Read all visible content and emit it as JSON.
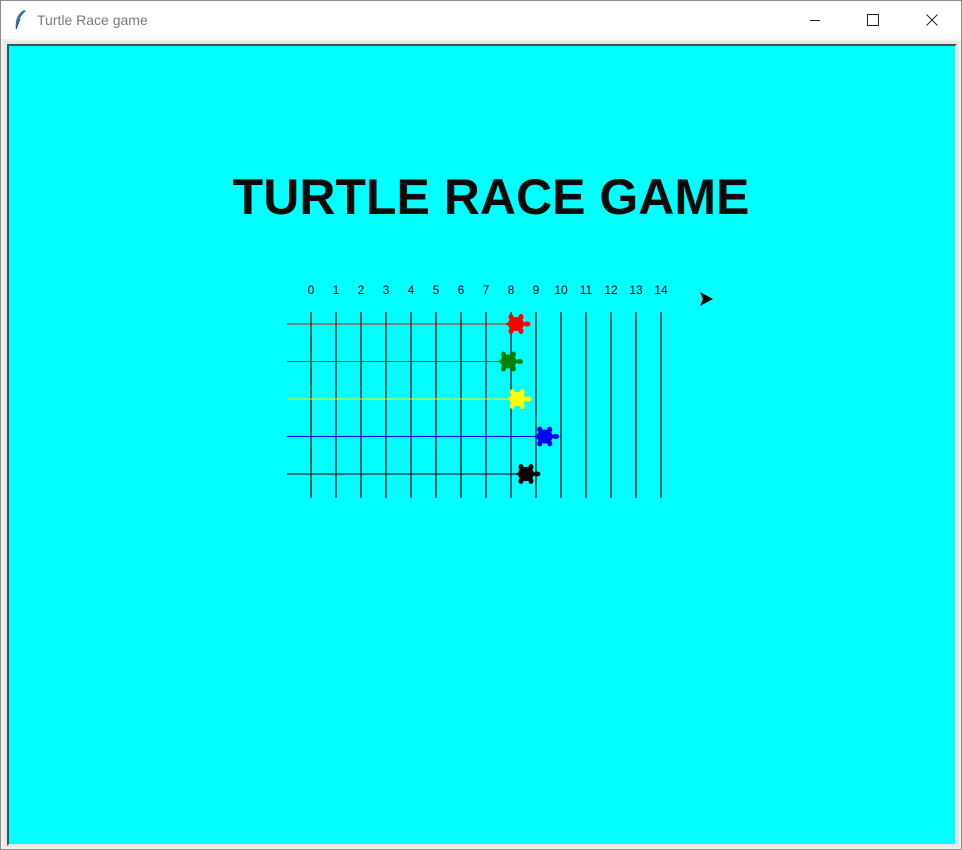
{
  "window": {
    "title": "Turtle Race game",
    "controls": {
      "minimize": "minimize-icon",
      "maximize": "maximize-icon",
      "close": "close-icon"
    }
  },
  "canvas": {
    "background": "#00ffff",
    "title": "TURTLE RACE GAME"
  },
  "track": {
    "columns": [
      "0",
      "1",
      "2",
      "3",
      "4",
      "5",
      "6",
      "7",
      "8",
      "9",
      "10",
      "11",
      "12",
      "13",
      "14"
    ],
    "lanes": [
      {
        "color": "#ff0000",
        "name": "red",
        "position": 8.2
      },
      {
        "color": "#008000",
        "name": "green",
        "position": 7.9
      },
      {
        "color": "#ffff00",
        "name": "yellow",
        "position": 8.25
      },
      {
        "color": "#0000ff",
        "name": "blue",
        "position": 9.35
      },
      {
        "color": "#000000",
        "name": "black",
        "position": 8.6
      }
    ],
    "pointer_icon": "arrow-cursor-icon"
  }
}
